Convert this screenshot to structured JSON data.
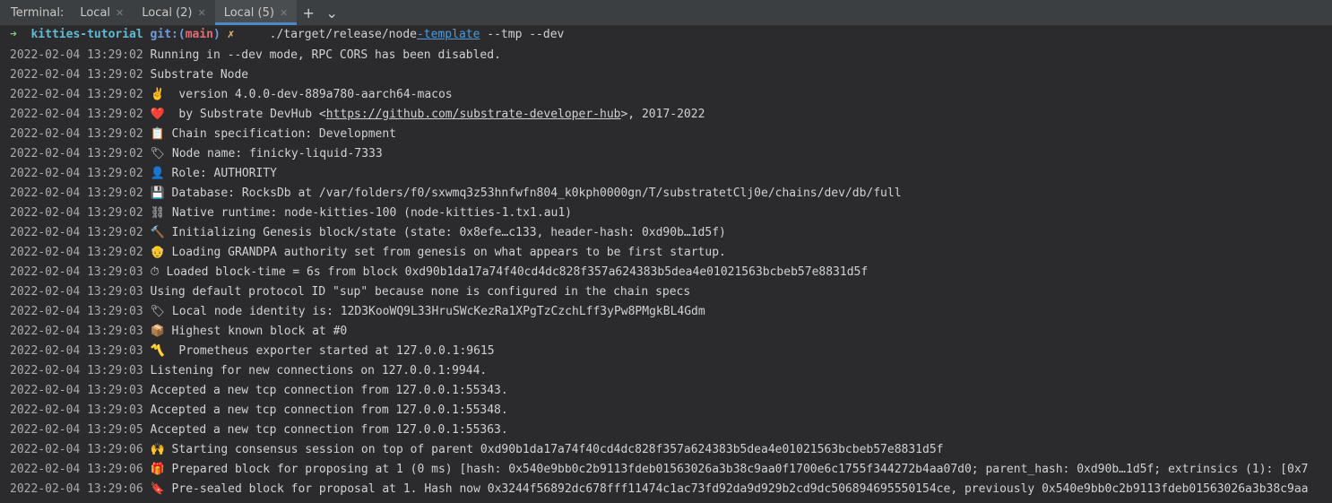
{
  "tabs": {
    "label": "Terminal:",
    "items": [
      {
        "label": "Local"
      },
      {
        "label": "Local (2)"
      },
      {
        "label": "Local (5)"
      }
    ],
    "add": "+",
    "more": "⌄"
  },
  "prompt": {
    "arrow": "➜",
    "repo": "kitties-tutorial",
    "git_prefix": "git:(",
    "branch": "main",
    "git_suffix": ")",
    "dirty": "✗",
    "cmd_a": "     ./target/release/node",
    "cmd_b": "-template",
    "cmd_c": " --tmp --dev"
  },
  "log": [
    {
      "ts": "2022-02-04 13:29:02",
      "msg": "Running in --dev mode, RPC CORS has been disabled."
    },
    {
      "ts": "2022-02-04 13:29:02",
      "msg": "Substrate Node"
    },
    {
      "ts": "2022-02-04 13:29:02",
      "msg": "✌️  version 4.0.0-dev-889a780-aarch64-macos"
    },
    {
      "ts": "2022-02-04 13:29:02",
      "msg_pre": "❤️  by Substrate DevHub <",
      "link": "https://github.com/substrate-developer-hub",
      "msg_post": ">, 2017-2022"
    },
    {
      "ts": "2022-02-04 13:29:02",
      "msg": "📋 Chain specification: Development"
    },
    {
      "ts": "2022-02-04 13:29:02",
      "msg": "🏷 Node name: finicky-liquid-7333"
    },
    {
      "ts": "2022-02-04 13:29:02",
      "msg": "👤 Role: AUTHORITY"
    },
    {
      "ts": "2022-02-04 13:29:02",
      "msg": "💾 Database: RocksDb at /var/folders/f0/sxwmq3z53hnfwfn804_k0kph0000gn/T/substratetClj0e/chains/dev/db/full"
    },
    {
      "ts": "2022-02-04 13:29:02",
      "msg": "⛓ Native runtime: node-kitties-100 (node-kitties-1.tx1.au1)"
    },
    {
      "ts": "2022-02-04 13:29:02",
      "msg": "🔨 Initializing Genesis block/state (state: 0x8efe…c133, header-hash: 0xd90b…1d5f)"
    },
    {
      "ts": "2022-02-04 13:29:02",
      "msg": "👴 Loading GRANDPA authority set from genesis on what appears to be first startup."
    },
    {
      "ts": "2022-02-04 13:29:03",
      "msg": "⏱ Loaded block-time = 6s from block 0xd90b1da17a74f40cd4dc828f357a624383b5dea4e01021563bcbeb57e8831d5f"
    },
    {
      "ts": "2022-02-04 13:29:03",
      "msg": "Using default protocol ID \"sup\" because none is configured in the chain specs"
    },
    {
      "ts": "2022-02-04 13:29:03",
      "msg": "🏷 Local node identity is: 12D3KooWQ9L33HruSWcKezRa1XPgTzCzchLff3yPw8PMgkBL4Gdm"
    },
    {
      "ts": "2022-02-04 13:29:03",
      "msg": "📦 Highest known block at #0"
    },
    {
      "ts": "2022-02-04 13:29:03",
      "msg": "〽️  Prometheus exporter started at 127.0.0.1:9615"
    },
    {
      "ts": "2022-02-04 13:29:03",
      "msg": "Listening for new connections on 127.0.0.1:9944."
    },
    {
      "ts": "2022-02-04 13:29:03",
      "msg": "Accepted a new tcp connection from 127.0.0.1:55343."
    },
    {
      "ts": "2022-02-04 13:29:03",
      "msg": "Accepted a new tcp connection from 127.0.0.1:55348."
    },
    {
      "ts": "2022-02-04 13:29:05",
      "msg": "Accepted a new tcp connection from 127.0.0.1:55363."
    },
    {
      "ts": "2022-02-04 13:29:06",
      "msg": "🙌 Starting consensus session on top of parent 0xd90b1da17a74f40cd4dc828f357a624383b5dea4e01021563bcbeb57e8831d5f"
    },
    {
      "ts": "2022-02-04 13:29:06",
      "msg": "🎁 Prepared block for proposing at 1 (0 ms) [hash: 0x540e9bb0c2b9113fdeb01563026a3b38c9aa0f1700e6c1755f344272b4aa07d0; parent_hash: 0xd90b…1d5f; extrinsics (1): [0x7"
    },
    {
      "ts": "2022-02-04 13:29:06",
      "msg": "🔖 Pre-sealed block for proposal at 1. Hash now 0x3244f56892dc678fff11474c1ac73fd92da9d929b2cd9dc506894695550154ce, previously 0x540e9bb0c2b9113fdeb01563026a3b38c9aa"
    }
  ]
}
